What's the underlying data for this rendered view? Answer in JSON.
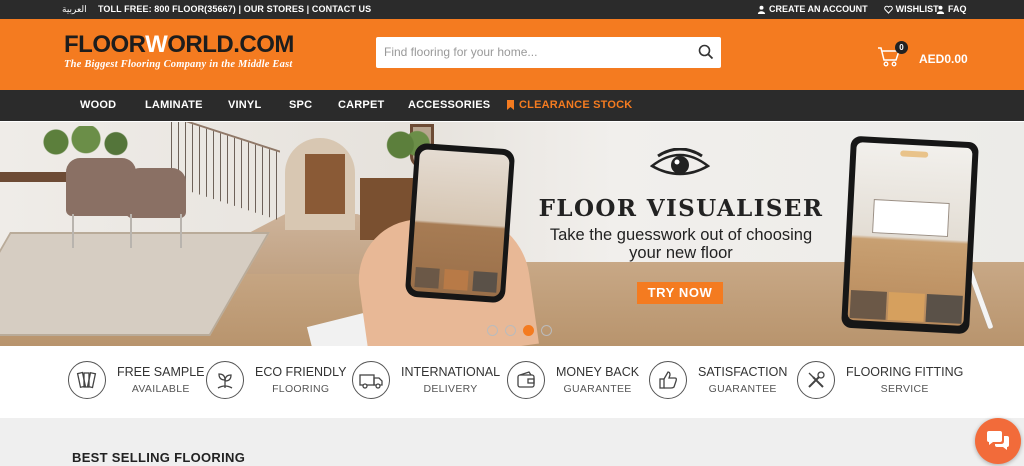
{
  "colors": {
    "accent": "#f47b20",
    "dark_bar": "#2b2b2b",
    "chat": "#f26b3a"
  },
  "topbar": {
    "language_link": "العربية",
    "toll_free": "TOLL FREE: 800 FLOOR(35667)",
    "separator": " | ",
    "our_stores": "OUR STORES",
    "contact_us": "CONTACT US",
    "create_account": "CREATE AN ACCOUNT",
    "wishlist": "WISHLIST",
    "faq": "FAQ"
  },
  "header": {
    "logo_part1": "FLOOR",
    "logo_w": "W",
    "logo_part2": "ORLD.COM",
    "tagline": "The Biggest Flooring Company in the Middle East",
    "search_placeholder": "Find flooring for your home...",
    "cart_count": "0",
    "cart_total": "AED0.00"
  },
  "nav": {
    "items": [
      "WOOD",
      "LAMINATE",
      "VINYL",
      "SPC",
      "CARPET",
      "ACCESSORIES"
    ],
    "clearance": "CLEARANCE STOCK"
  },
  "hero": {
    "title": "FLOOR VISUALISER",
    "subtitle_line1": "Take the guesswork out of choosing",
    "subtitle_line2": "your new floor",
    "cta": "TRY NOW",
    "slide_count": 4,
    "active_slide": 3
  },
  "features": [
    {
      "title": "FREE SAMPLE",
      "sub": "AVAILABLE",
      "icon": "sample-swatch-icon"
    },
    {
      "title": "ECO FRIENDLY",
      "sub": "FLOORING",
      "icon": "eco-plant-icon"
    },
    {
      "title": "INTERNATIONAL",
      "sub": "DELIVERY",
      "icon": "delivery-truck-icon"
    },
    {
      "title": "MONEY BACK",
      "sub": "GUARANTEE",
      "icon": "wallet-icon"
    },
    {
      "title": "SATISFACTION",
      "sub": "GUARANTEE",
      "icon": "thumbs-up-icon"
    },
    {
      "title": "FLOORING FITTING",
      "sub": "SERVICE",
      "icon": "tools-icon"
    }
  ],
  "sections": {
    "best_selling": "BEST SELLING FLOORING"
  }
}
